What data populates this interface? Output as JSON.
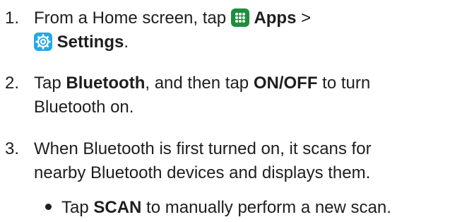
{
  "steps": [
    {
      "number": "1.",
      "line1_prefix": "From a Home screen, tap ",
      "apps_label": "Apps",
      "separator": " >",
      "settings_label": "Settings",
      "line2_suffix": "."
    },
    {
      "number": "2.",
      "line1_prefix": "Tap ",
      "bluetooth_label": "Bluetooth",
      "line1_mid": ", and then tap ",
      "onoff_label": "ON/OFF",
      "line1_suffix": " to turn",
      "line2": "Bluetooth on."
    },
    {
      "number": "3.",
      "line1": "When Bluetooth is first turned on, it scans for",
      "line2": "nearby Bluetooth devices and displays them."
    }
  ],
  "bullet": {
    "prefix": "Tap ",
    "scan_label": "SCAN",
    "suffix": " to manually perform a new scan."
  },
  "icons": {
    "apps": "apps-grid-icon",
    "settings": "settings-gear-icon"
  },
  "colors": {
    "apps_icon": "#1d8f3c",
    "settings_icon": "#24a9e6",
    "text": "#1e1e1e"
  }
}
